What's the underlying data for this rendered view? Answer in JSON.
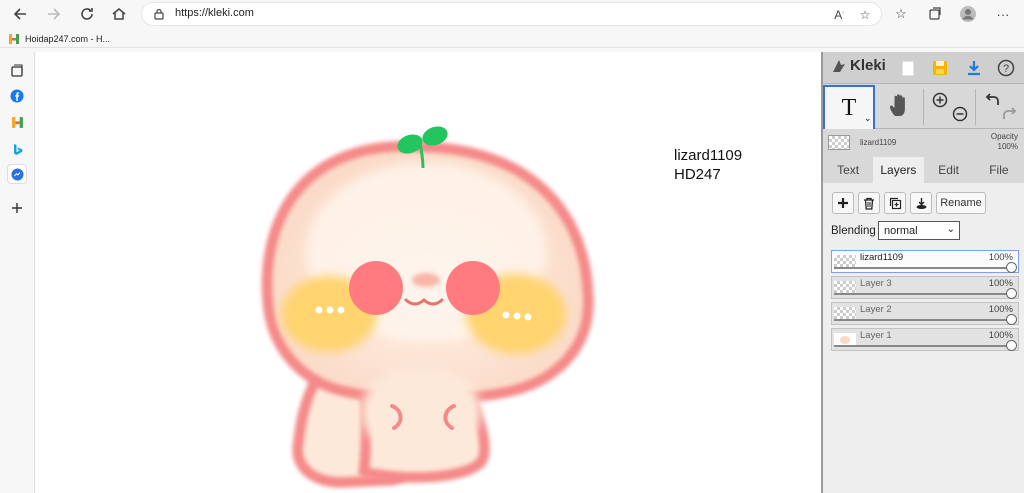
{
  "browser": {
    "url": "https://kleki.com",
    "favorites": [
      {
        "label": "Hoidap247.com - H..."
      }
    ]
  },
  "canvas": {
    "text_lines": [
      "lizard1109",
      "HD247"
    ]
  },
  "kleki": {
    "logo": "Kleki",
    "current_layer": {
      "name": "lizard1109",
      "opacity_label": "Opacity",
      "opacity_value": "100%"
    },
    "tabs": [
      {
        "label": "Text",
        "active": false
      },
      {
        "label": "Layers",
        "active": true
      },
      {
        "label": "Edit",
        "active": false
      },
      {
        "label": "File",
        "active": false
      }
    ],
    "rename_label": "Rename",
    "blending_label": "Blending",
    "blending_value": "normal",
    "layers": [
      {
        "name": "lizard1109",
        "opacity": "100%",
        "selected": true
      },
      {
        "name": "Layer 3",
        "opacity": "100%",
        "selected": false
      },
      {
        "name": "Layer 2",
        "opacity": "100%",
        "selected": false
      },
      {
        "name": "Layer 1",
        "opacity": "100%",
        "selected": false
      }
    ]
  },
  "colors": {
    "accent": "#3a6fd8",
    "mushroom_outline": "#f58a8a",
    "mushroom_fill": "#fde6d6",
    "cheek_yellow": "#ffd36e",
    "cheek_pink": "#ff7b7f",
    "sprout": "#22c55e"
  }
}
